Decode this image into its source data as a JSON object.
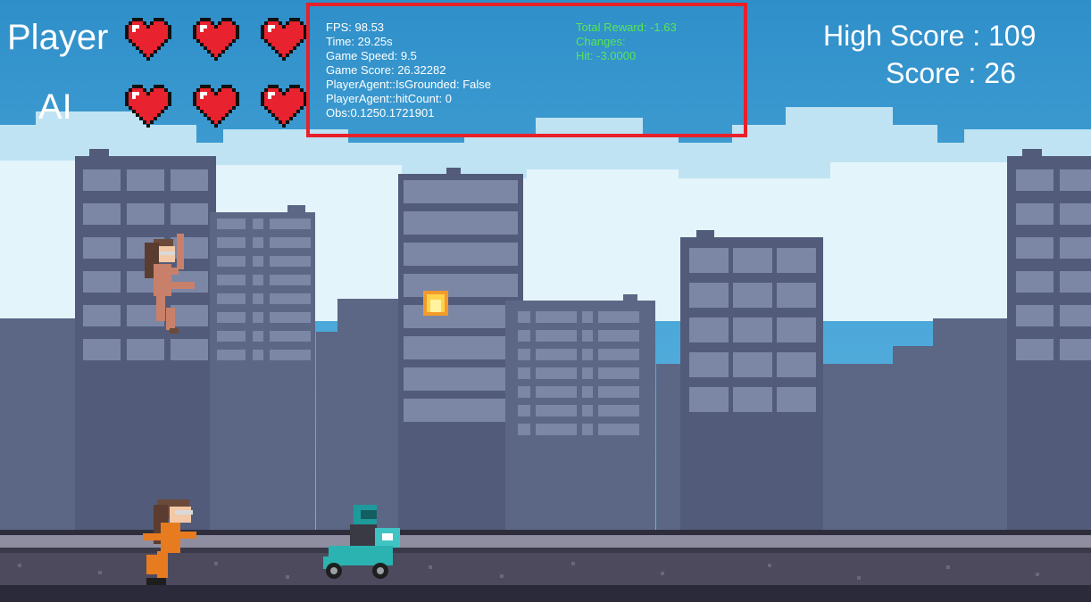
{
  "hud": {
    "player_label": "Player",
    "ai_label": "AI",
    "player_lives": 3,
    "ai_lives": 3,
    "high_score_text": "High Score : 109",
    "score_text": "Score : 26"
  },
  "debug": {
    "lines_left": [
      "FPS: 98.53",
      "Time: 29.25s",
      "Game Speed: 9.5",
      "Game Score: 26.32282",
      "PlayerAgent::IsGrounded: False",
      "PlayerAgent::hitCount: 0",
      "Obs:0.1250.1721901"
    ],
    "lines_right": [
      "Total Reward: -1.63",
      "Changes:",
      "Hit: -3.0000"
    ]
  },
  "colors": {
    "sky": "#4aa6d8",
    "building": "#5c6786",
    "window": "#7c87a6",
    "road": "#4d4a5e",
    "heart": "#e8222e",
    "debug_border": "#e8202a",
    "debug_positive_text": "#57e657"
  },
  "sprites": {
    "player_character": "running-woman-orange-suit",
    "ai_character": "jumping-woman-pink-suit",
    "obstacle": "delivery-scooter-rider",
    "projectile": "fireball"
  }
}
